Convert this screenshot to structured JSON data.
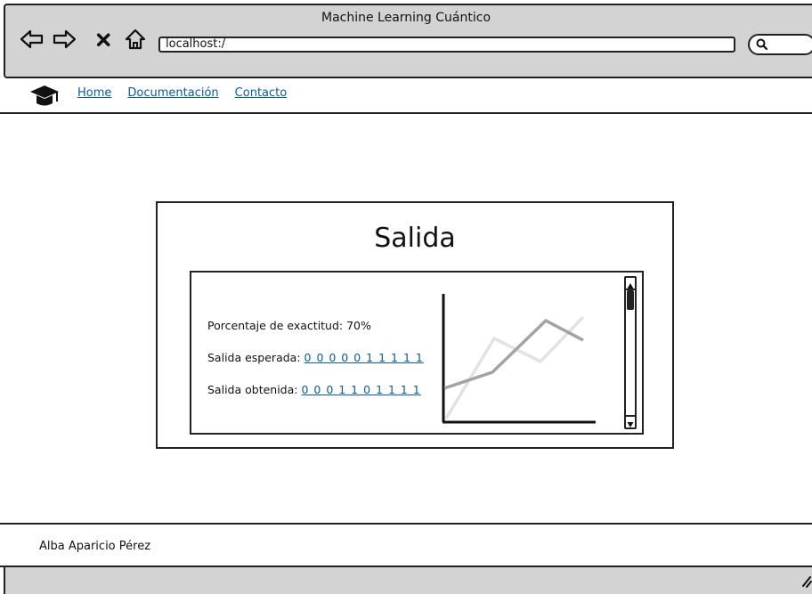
{
  "window": {
    "title": "Machine Learning Cuántico"
  },
  "browser": {
    "back_icon": "back-arrow-icon",
    "forward_icon": "forward-arrow-icon",
    "stop_icon": "close-icon",
    "home_icon": "home-icon",
    "address": "localhost:/",
    "search_icon": "search-icon"
  },
  "navbar": {
    "logo_icon": "graduation-cap-icon",
    "links": [
      "Home",
      "Documentación",
      "Contacto"
    ]
  },
  "output": {
    "title": "Salida",
    "accuracy_label": "Porcentaje de exactitud: 70%",
    "expected_label": "Salida esperada:",
    "expected_value": "0 0 0 0 0 1 1 1 1 1",
    "obtained_label": "Salida obtenida:",
    "obtained_value": "0 0 0 1 1 0 1 1 1 1"
  },
  "footer": {
    "author": "Alba Aparicio Pérez"
  },
  "colors": {
    "link": "#0b5a9e",
    "chrome": "#d3d3d3"
  }
}
